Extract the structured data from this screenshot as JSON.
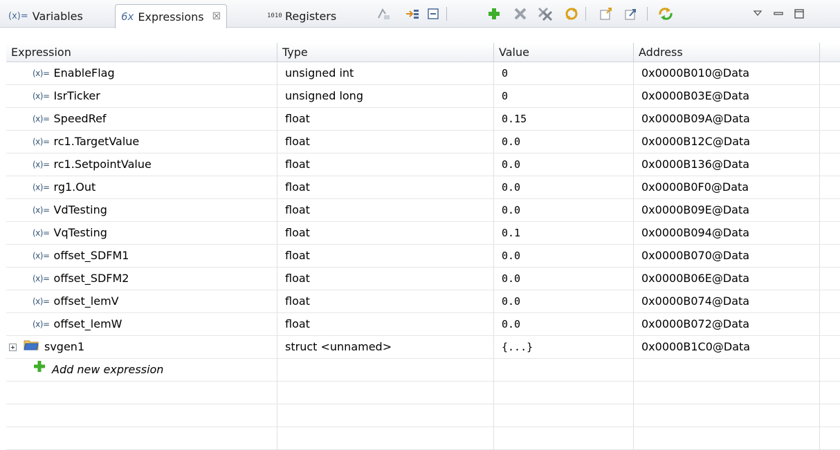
{
  "tabs": [
    {
      "icon": "(x)=",
      "label": "Variables"
    },
    {
      "icon": "6x",
      "label": "Expressions",
      "close": "☒"
    },
    {
      "icon": "1010",
      "label": "Registers"
    }
  ],
  "table": {
    "columns": [
      "Expression",
      "Type",
      "Value",
      "Address"
    ],
    "var_icon": "(x)=",
    "rows": [
      {
        "expr": "EnableFlag",
        "type": "unsigned int",
        "value": "0",
        "address": "0x0000B010@Data"
      },
      {
        "expr": "IsrTicker",
        "type": "unsigned long",
        "value": "0",
        "address": "0x0000B03E@Data"
      },
      {
        "expr": "SpeedRef",
        "type": "float",
        "value": "0.15",
        "address": "0x0000B09A@Data"
      },
      {
        "expr": "rc1.TargetValue",
        "type": "float",
        "value": "0.0",
        "address": "0x0000B12C@Data"
      },
      {
        "expr": "rc1.SetpointValue",
        "type": "float",
        "value": "0.0",
        "address": "0x0000B136@Data"
      },
      {
        "expr": "rg1.Out",
        "type": "float",
        "value": "0.0",
        "address": "0x0000B0F0@Data"
      },
      {
        "expr": "VdTesting",
        "type": "float",
        "value": "0.0",
        "address": "0x0000B09E@Data"
      },
      {
        "expr": "VqTesting",
        "type": "float",
        "value": "0.1",
        "address": "0x0000B094@Data"
      },
      {
        "expr": "offset_SDFM1",
        "type": "float",
        "value": "0.0",
        "address": "0x0000B070@Data"
      },
      {
        "expr": "offset_SDFM2",
        "type": "float",
        "value": "0.0",
        "address": "0x0000B06E@Data"
      },
      {
        "expr": "offset_lemV",
        "type": "float",
        "value": "0.0",
        "address": "0x0000B074@Data"
      },
      {
        "expr": "offset_lemW",
        "type": "float",
        "value": "0.0",
        "address": "0x0000B072@Data"
      }
    ],
    "struct_row": {
      "expr": "svgen1",
      "type": "struct <unnamed>",
      "value": "{...}",
      "address": "0x0000B1C0@Data"
    },
    "add_expression": "Add new expression"
  },
  "colors": {
    "accent_green": "#3fae2a",
    "delete_gray": "#9aa1aa",
    "folder_blue": "#3f74c9"
  }
}
